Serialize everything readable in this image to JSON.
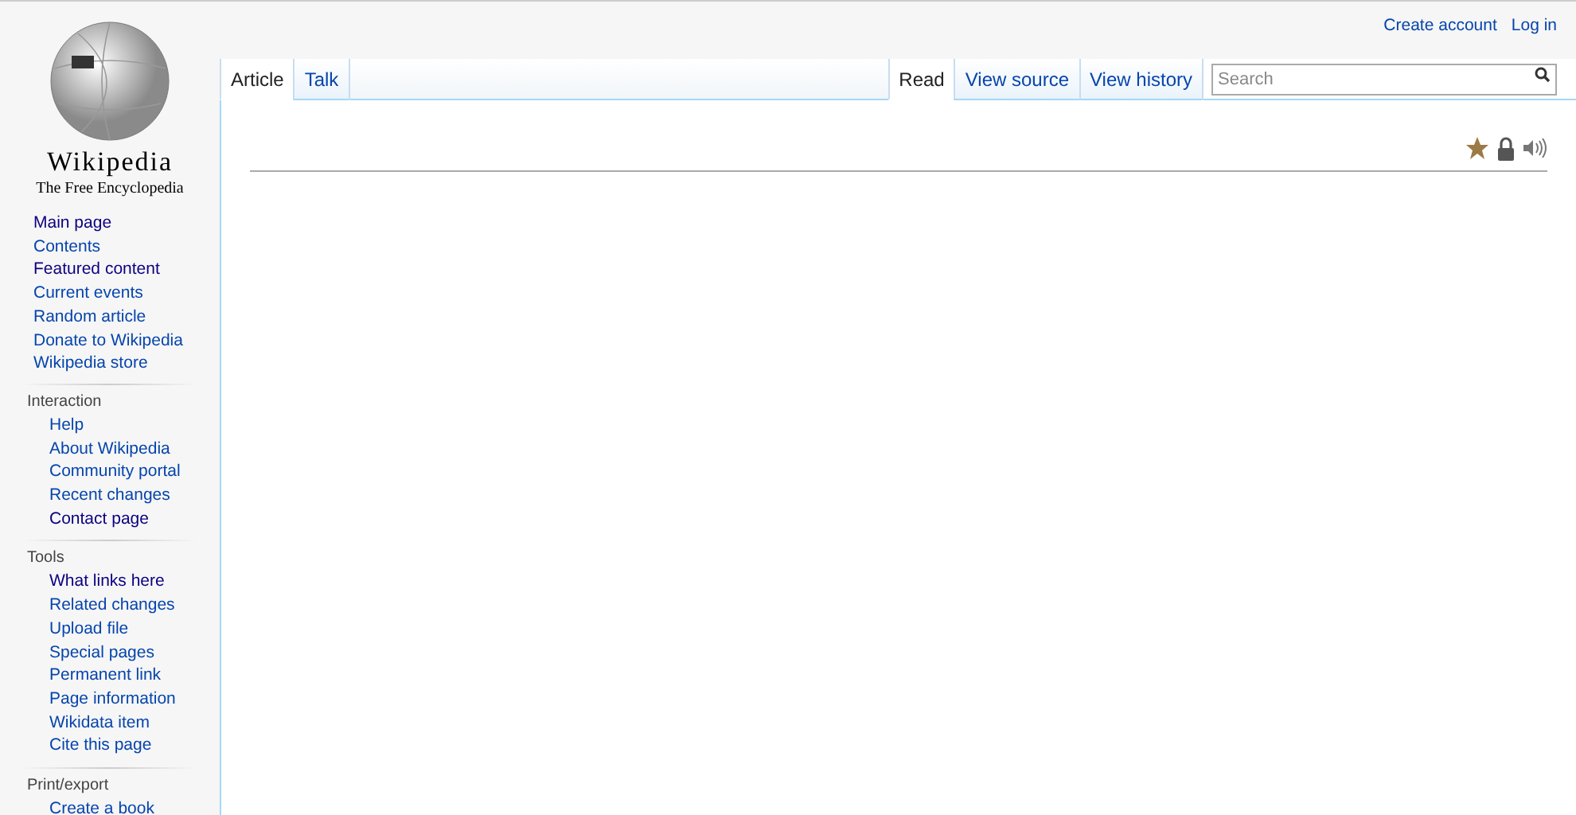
{
  "logo": {
    "wordmark": "Wikipedia",
    "tagline": "The Free Encyclopedia"
  },
  "personal_links": [
    "Create account",
    "Log in"
  ],
  "left_tabs": [
    {
      "label": "Article",
      "selected": true
    },
    {
      "label": "Talk",
      "selected": false
    }
  ],
  "right_tabs": [
    {
      "label": "Read",
      "selected": true
    },
    {
      "label": "View source",
      "selected": false
    },
    {
      "label": "View history",
      "selected": false
    }
  ],
  "search": {
    "placeholder": "Search"
  },
  "sidebar": {
    "navigation": [
      {
        "label": "Main page",
        "visited": true
      },
      {
        "label": "Contents",
        "visited": false
      },
      {
        "label": "Featured content",
        "visited": true
      },
      {
        "label": "Current events",
        "visited": false
      },
      {
        "label": "Random article",
        "visited": false
      },
      {
        "label": "Donate to Wikipedia",
        "visited": false
      },
      {
        "label": "Wikipedia store",
        "visited": false
      }
    ],
    "portals": [
      {
        "heading": "Interaction",
        "items": [
          {
            "label": "Help",
            "visited": false
          },
          {
            "label": "About Wikipedia",
            "visited": false
          },
          {
            "label": "Community portal",
            "visited": false
          },
          {
            "label": "Recent changes",
            "visited": false
          },
          {
            "label": "Contact page",
            "visited": true
          }
        ]
      },
      {
        "heading": "Tools",
        "items": [
          {
            "label": "What links here",
            "visited": true
          },
          {
            "label": "Related changes",
            "visited": false
          },
          {
            "label": "Upload file",
            "visited": false
          },
          {
            "label": "Special pages",
            "visited": false
          },
          {
            "label": "Permanent link",
            "visited": false
          },
          {
            "label": "Page information",
            "visited": false
          },
          {
            "label": "Wikidata item",
            "visited": false
          },
          {
            "label": "Cite this page",
            "visited": false
          }
        ]
      },
      {
        "heading": "Print/export",
        "items": [
          {
            "label": "Create a book",
            "visited": false
          }
        ]
      }
    ]
  }
}
